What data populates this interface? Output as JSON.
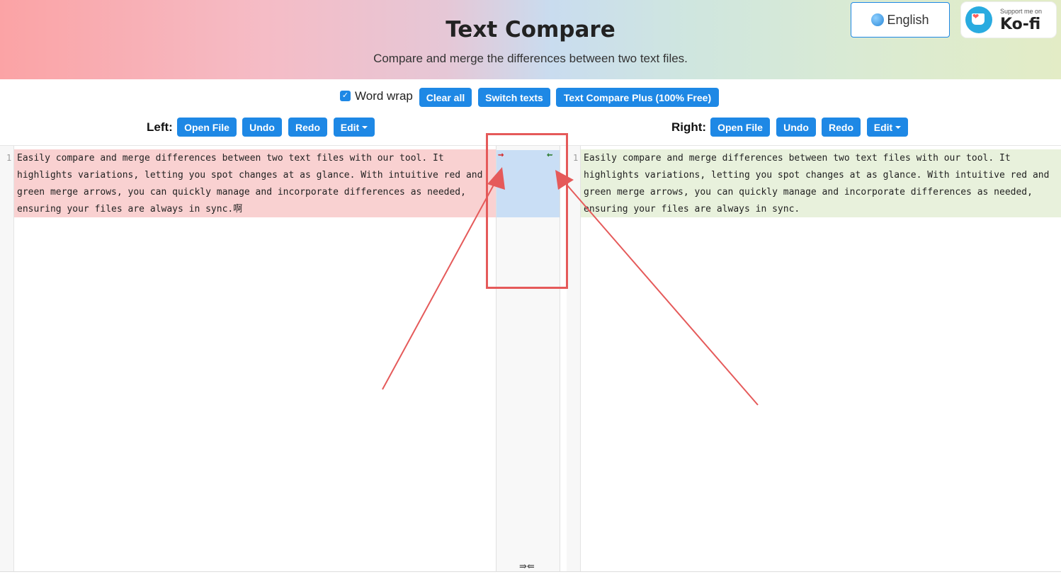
{
  "header": {
    "title": "Text Compare",
    "subtitle": "Compare and merge the differences between two text files.",
    "language_button": "English",
    "kofi_support": "Support me on",
    "kofi_name": "Ko-fi"
  },
  "toolbar": {
    "word_wrap_label": "Word wrap",
    "word_wrap_checked": true,
    "clear_all": "Clear all",
    "switch_texts": "Switch texts",
    "plus": "Text Compare Plus (100% Free)"
  },
  "left": {
    "label": "Left:",
    "open_file": "Open File",
    "undo": "Undo",
    "redo": "Redo",
    "edit": "Edit",
    "line_number": "1",
    "text": "Easily compare and merge differences between two text files with our tool. It highlights variations, letting you spot changes at as glance. With intuitive red and green merge arrows, you can quickly manage and incorporate differences as needed, ensuring your files are always in sync.啊"
  },
  "right": {
    "label": "Right:",
    "open_file": "Open File",
    "undo": "Undo",
    "redo": "Redo",
    "edit": "Edit",
    "line_number": "1",
    "text": "Easily compare and merge differences between two text files with our tool. It highlights variations, letting you spot changes at as glance. With intuitive red and green merge arrows, you can quickly manage and incorporate differences as needed, ensuring your files are always in sync."
  },
  "middle": {
    "merge_right_arrow": "⇝",
    "merge_left_arrow": "⇜",
    "collapse_icon": "⇛⇚"
  },
  "colors": {
    "accent": "#1e88e5",
    "left_diff": "#f9d1d1",
    "right_diff": "#e8f1dc",
    "middle_diff": "#c9def5",
    "annotation": "#e55a5a"
  }
}
